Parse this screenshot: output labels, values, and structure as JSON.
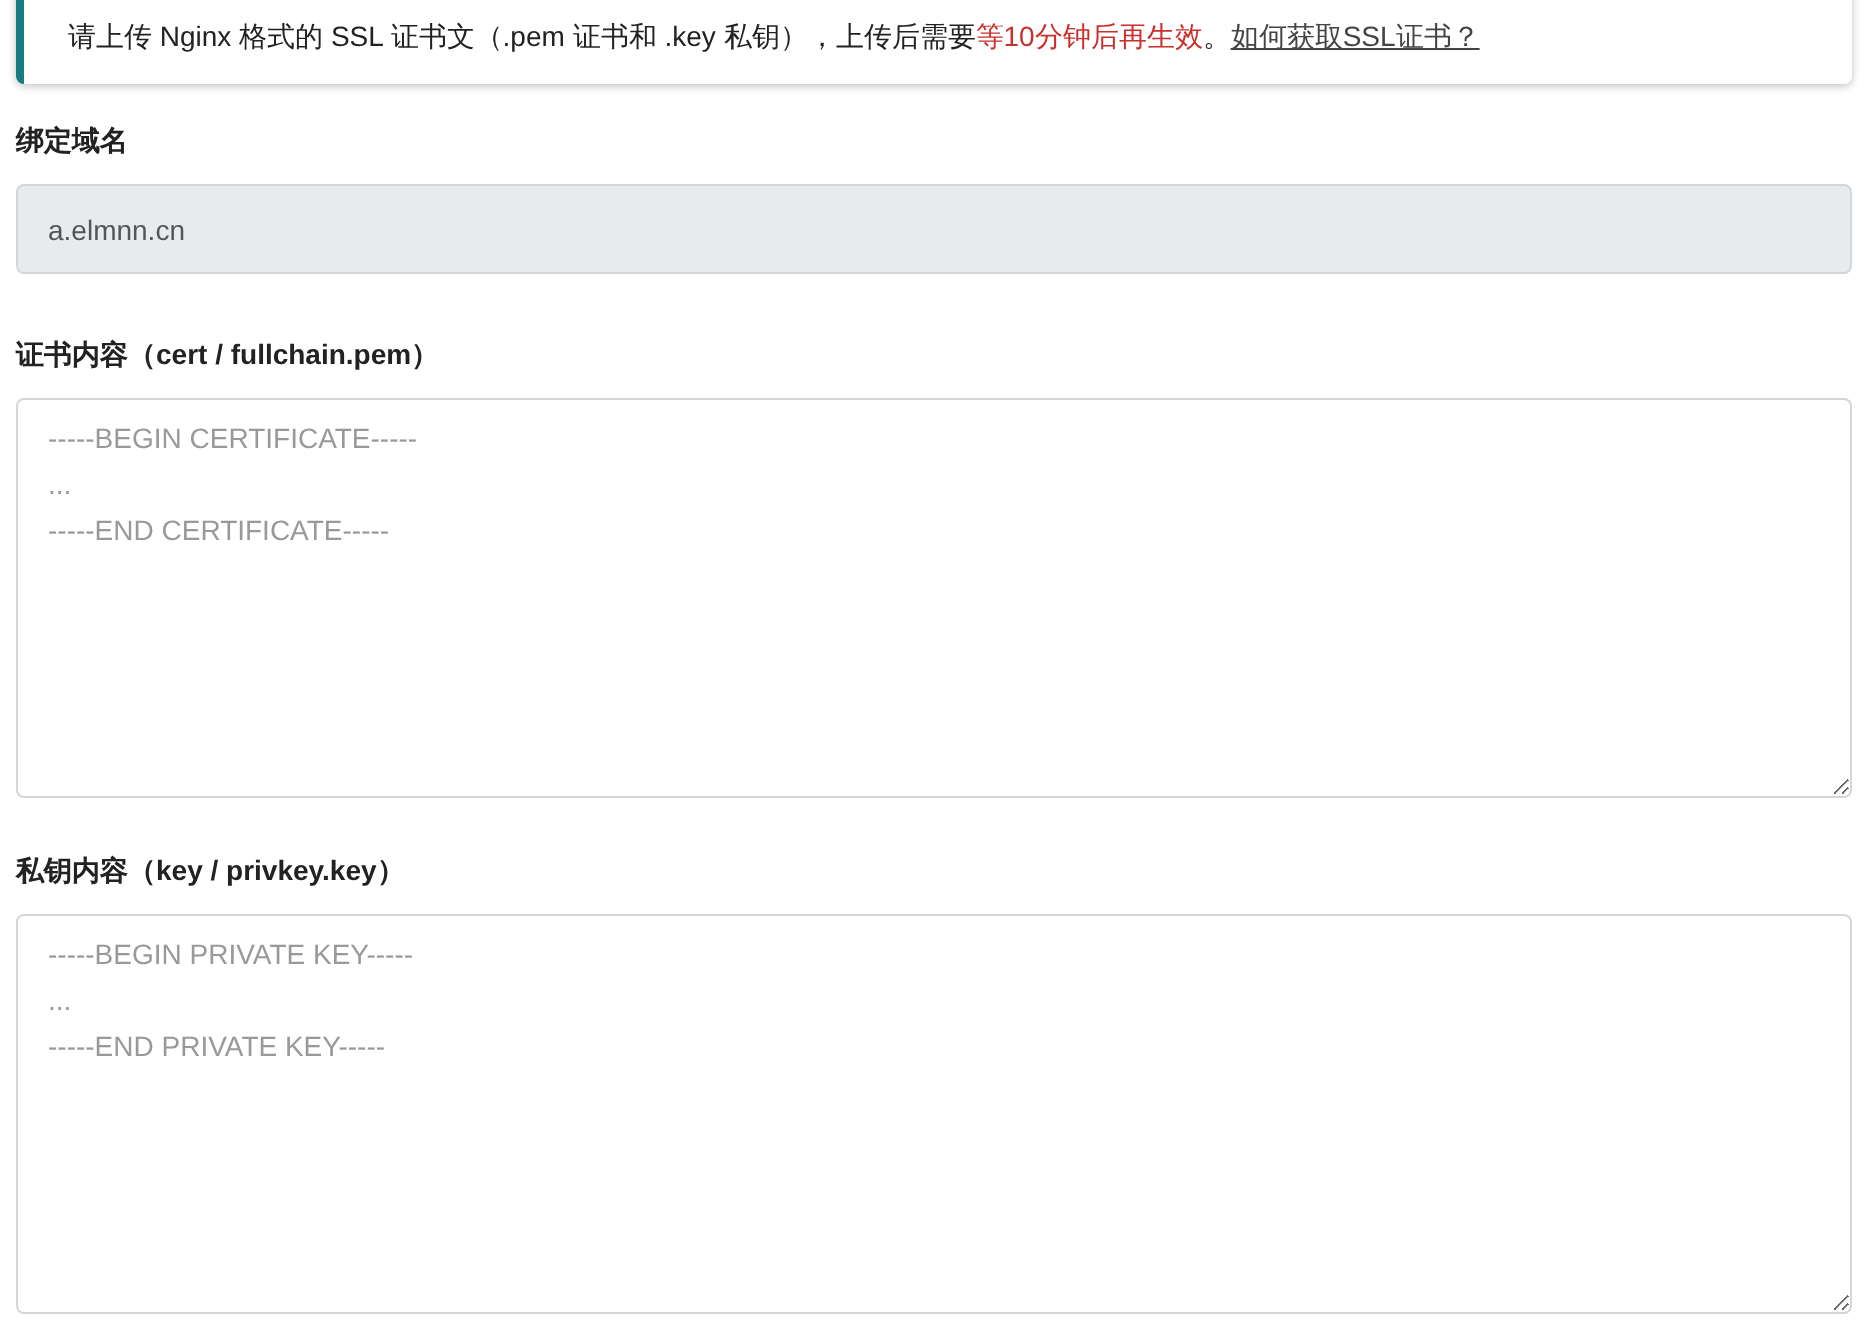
{
  "notice": {
    "parts": [
      {
        "kind": "text",
        "text": "请上传 Nginx 格式的 SSL 证书文（.pem 证书和 .key 私钥），上传后需要"
      },
      {
        "kind": "highlight",
        "text": "等10分钟后再生效"
      },
      {
        "kind": "text",
        "text": "。"
      },
      {
        "kind": "link",
        "text": "如何获取SSL证书？"
      }
    ]
  },
  "fields": [
    {
      "kind": "input",
      "label": "绑定域名",
      "value": "a.elmnn.cn",
      "disabled": true
    },
    {
      "kind": "textarea",
      "label": "证书内容（cert / fullchain.pem）",
      "placeholder": "-----BEGIN CERTIFICATE-----\n...\n-----END CERTIFICATE-----"
    },
    {
      "kind": "textarea",
      "label": "私钥内容（key / privkey.key）",
      "placeholder": "-----BEGIN PRIVATE KEY-----\n...\n-----END PRIVATE KEY-----"
    }
  ]
}
